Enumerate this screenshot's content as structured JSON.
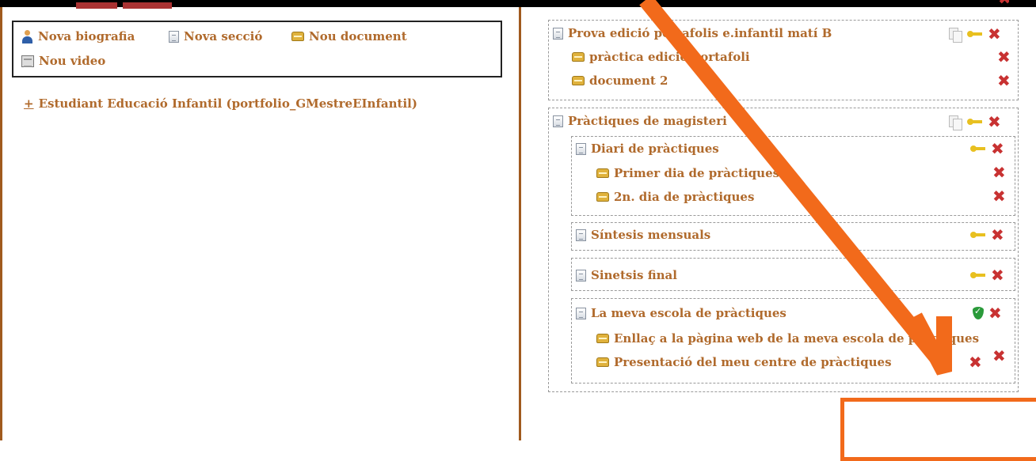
{
  "toolbar": {
    "new_biography": "Nova biografia",
    "new_section": "Nova secció",
    "new_document": "Nou document",
    "new_video": "Nou video"
  },
  "student_link": {
    "toggle": "+",
    "label": "Estudiant Educació Infantil (portfolio_GMestreEInfantil)"
  },
  "tree": {
    "sec1": {
      "title": "Prova edició portafolis e.infantil matí B",
      "docs": [
        "pràctica edició portafoli",
        "document 2"
      ]
    },
    "sec2": {
      "title": "Pràctiques de magisteri",
      "sub1": {
        "title": "Diari de pràctiques",
        "docs": [
          "Primer dia de pràctiques",
          "2n. dia de pràctiques"
        ]
      },
      "sub2": {
        "title": "Síntesis mensuals"
      },
      "sub3": {
        "title": "Sinetsis final"
      },
      "sub4": {
        "title": "La meva escola de pràctiques",
        "docs": [
          "Enllaç a la pàgina web de la meva escola de pràctiques",
          "Presentació del meu centre de pràctiques"
        ]
      }
    }
  },
  "colors": {
    "text": "#b06a2c",
    "annotation": "#f26a1b",
    "delete": "#c83232"
  }
}
